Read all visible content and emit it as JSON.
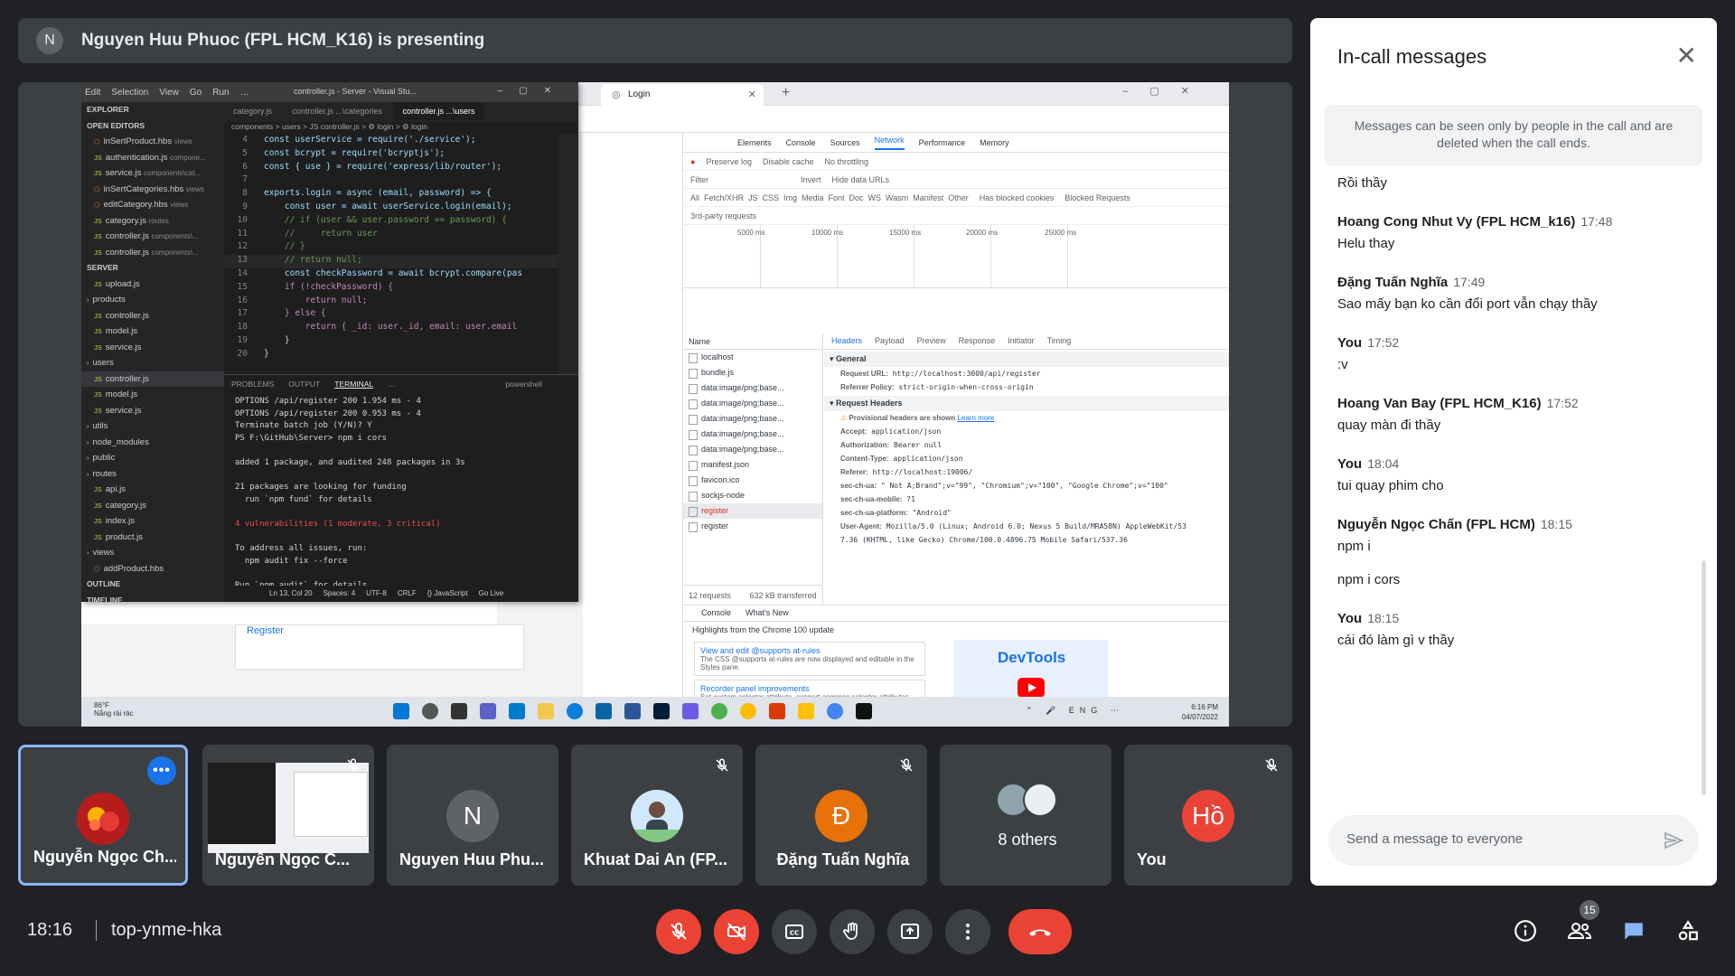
{
  "banner": {
    "avatar_letter": "N",
    "title": "Nguyen Huu Phuoc (FPL HCM_K16) is presenting"
  },
  "shared_screen": {
    "chrome": {
      "tab_title": "Login",
      "devtools_tabs": [
        "Elements",
        "Console",
        "Sources",
        "Network",
        "Performance",
        "Memory"
      ],
      "active_devtools_tab": "Network",
      "net_options": [
        "Preserve log",
        "Disable cache",
        "No throttling"
      ],
      "filter_types": "All  Fetch/XHR  JS  CSS  Img  Media  Font  Doc  WS  Wasm  Manifest  Other",
      "filter_placeholder": "Filter",
      "invert": "Invert",
      "hide_data_urls": "Hide data URLs",
      "blocked_cookies": "Has blocked cookies",
      "blocked_requests": "Blocked Requests",
      "third_party": "3rd-party requests",
      "timeline_ticks": [
        "5000 ms",
        "10000 ms",
        "15000 ms",
        "20000 ms",
        "25000 ms"
      ],
      "requests_header": "Name",
      "requests": [
        "localhost",
        "bundle.js",
        "data:image/png;base...",
        "data:image/png;base...",
        "data:image/png;base...",
        "data:image/png;base...",
        "data:image/png;base...",
        "manifest.json",
        "favicon.ico",
        "sockjs-node",
        "register",
        "register"
      ],
      "requests_footer": "12 requests",
      "transferred": "632 kB transferred",
      "detail_tabs": [
        "Headers",
        "Payload",
        "Preview",
        "Response",
        "Initiator",
        "Timing"
      ],
      "general_title": "General",
      "general": [
        {
          "k": "Request URL:",
          "v": "http://localhost:3000/api/register"
        },
        {
          "k": "Referrer Policy:",
          "v": "strict-origin-when-cross-origin"
        }
      ],
      "request_headers_title": "Request Headers",
      "provisional": "Provisional headers are shown",
      "learn_more": "Learn more",
      "request_headers": [
        {
          "k": "Accept:",
          "v": "application/json"
        },
        {
          "k": "Authorization:",
          "v": "Bearer null"
        },
        {
          "k": "Content-Type:",
          "v": "application/json"
        },
        {
          "k": "Referer:",
          "v": "http://localhost:19006/"
        },
        {
          "k": "sec-ch-ua:",
          "v": "\" Not A;Brand\";v=\"99\", \"Chromium\";v=\"100\", \"Google Chrome\";v=\"100\""
        },
        {
          "k": "sec-ch-ua-mobile:",
          "v": "?1"
        },
        {
          "k": "sec-ch-ua-platform:",
          "v": "\"Android\""
        },
        {
          "k": "User-Agent:",
          "v": "Mozilla/5.0 (Linux; Android 6.0; Nexus 5 Build/MRA58N) AppleWebKit/53"
        },
        {
          "k": "",
          "v": "7.36 (KHTML, like Gecko) Chrome/100.0.4896.75 Mobile Safari/537.36"
        }
      ],
      "drawer_tabs": [
        "Console",
        "What's New"
      ],
      "drawer_highlight": "Highlights from the Chrome 100 update",
      "whatsnew": [
        {
          "title": "View and edit @supports at-rules",
          "desc": "The CSS @supports at-rules are now displayed and editable in the Styles pane."
        },
        {
          "title": "Recorder panel improvements",
          "desc": "Set custom selector attribute, support common selector attributes, rename recording and more."
        }
      ],
      "devtools_logo": "DevTools",
      "login_link": "Register"
    },
    "vscode": {
      "menu": [
        "Edit",
        "Selection",
        "View",
        "Go",
        "Run",
        "…"
      ],
      "window_title": "controller.js - Server - Visual Stu...",
      "tabs": [
        "category.js",
        "controller.js ...\\categories",
        "controller.js ...\\users"
      ],
      "breadcrumb": "components > users > JS controller.js > ⚙ login > ⚙ login",
      "explorer_title": "EXPLORER",
      "sidebar": [
        {
          "t": "OPEN EDITORS",
          "hd": true
        },
        {
          "t": "inSertProduct.hbs",
          "d": "views"
        },
        {
          "t": "authentication.js",
          "d": "compone..."
        },
        {
          "t": "service.js",
          "d": "components\\cat..."
        },
        {
          "t": "inSertCategories.hbs",
          "d": "views"
        },
        {
          "t": "editCategory.hbs",
          "d": "views"
        },
        {
          "t": "category.js",
          "d": "routes"
        },
        {
          "t": "controller.js",
          "d": "components\\..."
        },
        {
          "t": "controller.js",
          "d": "components\\..."
        },
        {
          "t": "SERVER",
          "hd": true
        },
        {
          "t": "upload.js"
        },
        {
          "t": "products"
        },
        {
          "t": "controller.js"
        },
        {
          "t": "model.js"
        },
        {
          "t": "service.js"
        },
        {
          "t": "users"
        },
        {
          "t": "controller.js",
          "sel": true
        },
        {
          "t": "model.js"
        },
        {
          "t": "service.js"
        },
        {
          "t": "utils"
        },
        {
          "t": "node_modules"
        },
        {
          "t": "public"
        },
        {
          "t": "routes"
        },
        {
          "t": "api.js"
        },
        {
          "t": "category.js"
        },
        {
          "t": "index.js"
        },
        {
          "t": "product.js"
        },
        {
          "t": "views"
        },
        {
          "t": "addProduct.hbs"
        },
        {
          "t": "OUTLINE",
          "hd": true
        },
        {
          "t": "TIMELINE",
          "hd": true
        }
      ],
      "code_lines": [
        {
          "n": "4",
          "c": "const userService = require('./service');"
        },
        {
          "n": "5",
          "c": "const bcrypt = require('bcryptjs');"
        },
        {
          "n": "6",
          "c": "const { use } = require('express/lib/router');"
        },
        {
          "n": "7",
          "c": ""
        },
        {
          "n": "8",
          "c": "exports.login = async (email, password) => {"
        },
        {
          "n": "9",
          "c": "    const user = await userService.login(email);"
        },
        {
          "n": "10",
          "c": "    // if (user && user.password == password) {"
        },
        {
          "n": "11",
          "c": "    //     return user"
        },
        {
          "n": "12",
          "c": "    // }"
        },
        {
          "n": "13",
          "c": "    // return null;"
        },
        {
          "n": "14",
          "c": "    const checkPassword = await bcrypt.compare(pas"
        },
        {
          "n": "15",
          "c": "    if (!checkPassword) {"
        },
        {
          "n": "16",
          "c": "        return null;"
        },
        {
          "n": "17",
          "c": "    } else {"
        },
        {
          "n": "18",
          "c": "        return { _id: user._id, email: user.email"
        },
        {
          "n": "19",
          "c": "    }"
        },
        {
          "n": "20",
          "c": "}"
        }
      ],
      "terminal_tabs": [
        "PROBLEMS",
        "OUTPUT",
        "TERMINAL",
        "…"
      ],
      "terminal_shell": "powershell",
      "terminal_lines": [
        "OPTIONS /api/register 200 1.954 ms - 4",
        "OPTIONS /api/register 200 0.953 ms - 4",
        "Terminate batch job (Y/N)? Y",
        "PS F:\\GitHub\\Server> npm i cors",
        "",
        "added 1 package, and audited 248 packages in 3s",
        "",
        "21 packages are looking for funding",
        "  run `npm fund` for details",
        "",
        "4 vulnerabilities (1 moderate, 3 critical)",
        "",
        "To address all issues, run:",
        "  npm audit fix --force",
        "",
        "Run `npm audit` for details.",
        "PS F:\\GitHub\\Server> "
      ],
      "status": [
        "Ln 13, Col 20",
        "Spaces: 4",
        "UTF-8",
        "CRLF",
        "{} JavaScript",
        "Go Live"
      ]
    },
    "taskbar": {
      "temp": "86°F",
      "weather": "Nắng rải rác",
      "lang": "ENG",
      "time": "6:16 PM",
      "date": "04/07/2022"
    }
  },
  "tiles": [
    {
      "name": "Nguyễn Ngọc Ch...",
      "kind": "avatar-img"
    },
    {
      "name": "Nguyễn Ngọc C...",
      "kind": "screen"
    },
    {
      "name": "Nguyen Huu Phu...",
      "letter": "N"
    },
    {
      "name": "Khuat Dai An (FP...",
      "kind": "photo"
    },
    {
      "name": "Đặng Tuấn Nghĩa",
      "letter": "Đ"
    },
    {
      "name": "8 others",
      "kind": "group"
    },
    {
      "name": "You",
      "letter": "Hồ"
    }
  ],
  "chat": {
    "title": "In-call messages",
    "notice": "Messages can be seen only by people in the call and are deleted when the call ends.",
    "partial_message": "Rồi thầy",
    "messages": [
      {
        "who": "Hoang Cong Nhut Vy (FPL HCM_k16)",
        "time": "17:48",
        "lines": [
          "Helu thay"
        ]
      },
      {
        "who": "Đặng Tuấn Nghĩa",
        "time": "17:49",
        "lines": [
          "Sao mấy bạn ko cần đổi port vẫn chạy thầy"
        ]
      },
      {
        "who": "You",
        "time": "17:52",
        "lines": [
          ":v"
        ]
      },
      {
        "who": "Hoang Van Bay (FPL HCM_K16)",
        "time": "17:52",
        "lines": [
          "quay màn đi thầy"
        ]
      },
      {
        "who": "You",
        "time": "18:04",
        "lines": [
          "tui quay phim cho"
        ]
      },
      {
        "who": "Nguyễn Ngọc Chấn (FPL HCM)",
        "time": "18:15",
        "lines": [
          "npm i",
          "npm i cors"
        ]
      },
      {
        "who": "You",
        "time": "18:15",
        "lines": [
          "cái đó làm gì v thầy"
        ]
      }
    ],
    "input_placeholder": "Send a message to everyone"
  },
  "bottom": {
    "time": "18:16",
    "meeting_code": "top-ynme-hka",
    "people_count": "15"
  },
  "colors": {
    "background": "#202124",
    "surface": "#3c4043",
    "danger": "#ea4335",
    "accent": "#1a73e8",
    "chat_icon": "#8ab4f8"
  }
}
